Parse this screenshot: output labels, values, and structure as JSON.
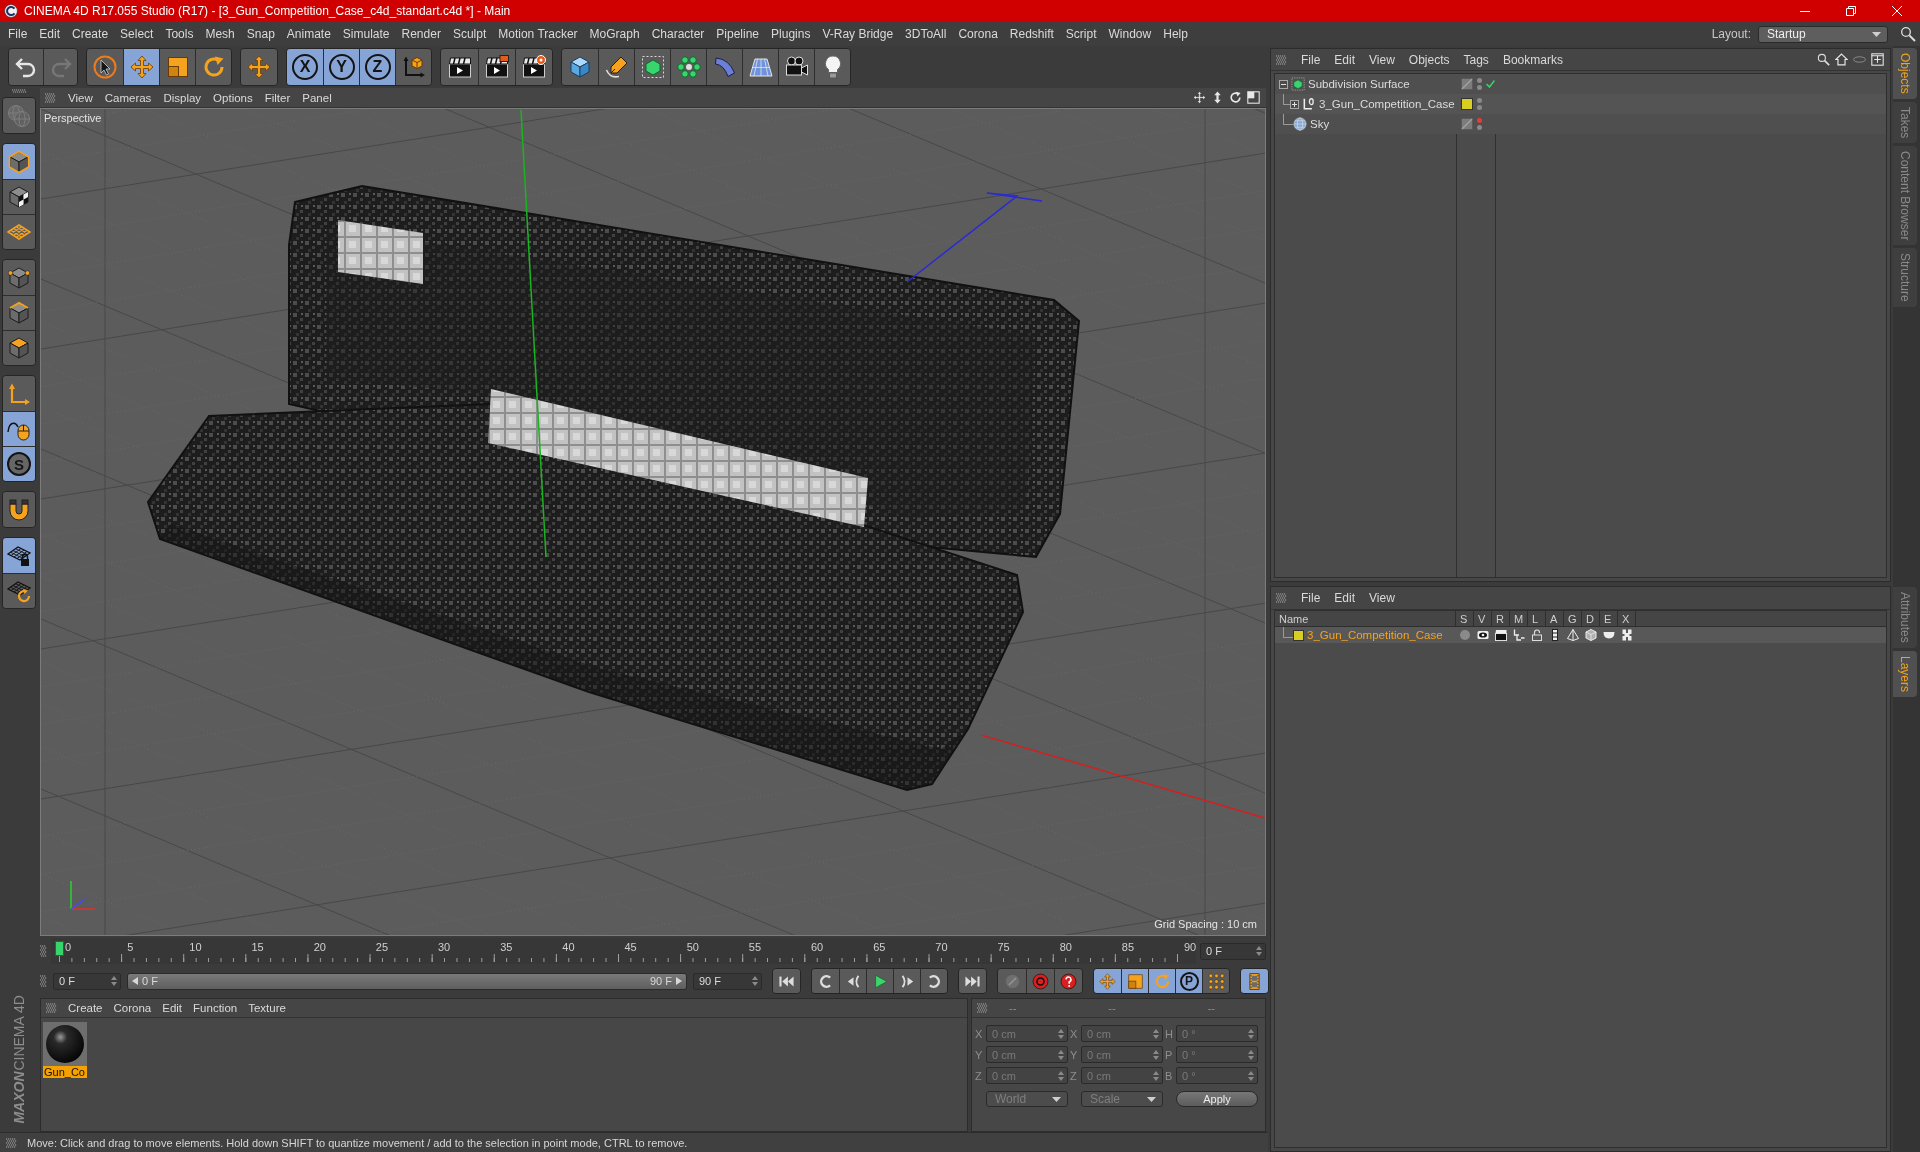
{
  "window": {
    "title": "CINEMA 4D R17.055 Studio (R17) - [3_Gun_Competition_Case_c4d_standart.c4d *] - Main"
  },
  "menu_bar": [
    "File",
    "Edit",
    "Create",
    "Select",
    "Tools",
    "Mesh",
    "Snap",
    "Animate",
    "Simulate",
    "Render",
    "Sculpt",
    "Motion Tracker",
    "MoGraph",
    "Character",
    "Pipeline",
    "Plugins",
    "V-Ray Bridge",
    "3DToAll",
    "Corona",
    "Redshift",
    "Script",
    "Window",
    "Help"
  ],
  "layout": {
    "label": "Layout:",
    "value": "Startup"
  },
  "toolbar": [
    [
      {
        "kind": "undo",
        "selected": false,
        "disabled": false
      },
      {
        "kind": "redo",
        "selected": false,
        "disabled": true
      }
    ],
    [
      {
        "kind": "select",
        "selected": false
      },
      {
        "kind": "move",
        "selected": true
      },
      {
        "kind": "scale",
        "selected": false
      },
      {
        "kind": "rotate",
        "selected": false
      }
    ],
    [
      {
        "kind": "transform",
        "selected": false
      }
    ],
    [
      {
        "kind": "axis-lock",
        "label": "X",
        "selected": true
      },
      {
        "kind": "axis-lock",
        "label": "Y",
        "selected": true
      },
      {
        "kind": "axis-lock",
        "label": "Z",
        "selected": true
      },
      {
        "kind": "coordinates",
        "selected": false
      }
    ],
    [
      {
        "kind": "render-view",
        "selected": false
      },
      {
        "kind": "render-picture",
        "selected": false
      },
      {
        "kind": "render-settings",
        "selected": false
      }
    ],
    [
      {
        "kind": "cube",
        "selected": false
      },
      {
        "kind": "pen",
        "selected": false
      },
      {
        "kind": "subdivision",
        "selected": false
      },
      {
        "kind": "cloner",
        "selected": false
      },
      {
        "kind": "deformer",
        "selected": false
      },
      {
        "kind": "floor",
        "selected": false
      },
      {
        "kind": "camera",
        "selected": false
      },
      {
        "kind": "light",
        "selected": false
      }
    ]
  ],
  "left_toolbar": [
    [
      {
        "kind": "make-editable",
        "selected": false,
        "disabled": true
      }
    ],
    [
      {
        "kind": "model",
        "selected": true
      },
      {
        "kind": "texture",
        "selected": false
      },
      {
        "kind": "workplane",
        "selected": false
      }
    ],
    [
      {
        "kind": "points",
        "selected": false
      },
      {
        "kind": "edges",
        "selected": false
      },
      {
        "kind": "polygons",
        "selected": false
      }
    ],
    [
      {
        "kind": "axis",
        "selected": false
      },
      {
        "kind": "tweak",
        "selected": true
      },
      {
        "kind": "snap",
        "label": "S",
        "selected": true
      }
    ],
    [
      {
        "kind": "magnet",
        "selected": false
      }
    ],
    [
      {
        "kind": "workplane-lock",
        "selected": true
      },
      {
        "kind": "workplane-align",
        "selected": false
      }
    ]
  ],
  "viewport": {
    "menu": [
      "View",
      "Cameras",
      "Display",
      "Options",
      "Filter",
      "Panel"
    ],
    "camera": "Perspective",
    "grid_spacing": "Grid Spacing : 10 cm"
  },
  "timeline": {
    "ticks": [
      "0",
      "5",
      "10",
      "15",
      "20",
      "25",
      "30",
      "35",
      "40",
      "45",
      "50",
      "55",
      "60",
      "65",
      "70",
      "75",
      "80",
      "85",
      "90"
    ],
    "playhead": {
      "level": 0
    },
    "current_frame": "0 F"
  },
  "transport": {
    "start_frame": "0 F",
    "range": {
      "start_label": "0 F",
      "end_label": "90 F",
      "level": 1
    },
    "end_frame": "90 F",
    "buttons": [
      [
        {
          "kind": "go-start",
          "selected": false
        }
      ],
      [
        {
          "kind": "prev-key",
          "selected": false
        },
        {
          "kind": "prev-frame",
          "selected": false
        },
        {
          "kind": "play",
          "selected": false
        },
        {
          "kind": "next-frame",
          "selected": false
        },
        {
          "kind": "next-key",
          "selected": false
        }
      ],
      [
        {
          "kind": "go-end",
          "selected": false
        }
      ],
      [
        {
          "kind": "record",
          "selected": false,
          "disabled": true
        },
        {
          "kind": "autokey",
          "selected": false,
          "disabled": false
        },
        {
          "kind": "key-selection",
          "selected": false,
          "disabled": false
        }
      ],
      [
        {
          "kind": "position",
          "selected": true
        },
        {
          "kind": "scale",
          "selected": true
        },
        {
          "kind": "rotation",
          "selected": true
        },
        {
          "kind": "parameter",
          "label": "P",
          "selected": true
        },
        {
          "kind": "point-level",
          "selected": false
        }
      ],
      [
        {
          "kind": "timeline",
          "selected": true
        }
      ]
    ]
  },
  "material_manager": {
    "menu": [
      "Create",
      "Corona",
      "Edit",
      "Function",
      "Texture"
    ],
    "materials": [
      {
        "name": "Gun_Co",
        "selected": true
      }
    ]
  },
  "coordinates": {
    "headers": [
      "--",
      "--",
      "--"
    ],
    "disabled": true,
    "rows": [
      {
        "position_axis": "X",
        "position": "0 cm",
        "size_axis": "X",
        "size": "0 cm",
        "rotation_axis": "H",
        "rotation": "0 °"
      },
      {
        "position_axis": "Y",
        "position": "0 cm",
        "size_axis": "Y",
        "size": "0 cm",
        "rotation_axis": "P",
        "rotation": "0 °"
      },
      {
        "position_axis": "Z",
        "position": "0 cm",
        "size_axis": "Z",
        "size": "0 cm",
        "rotation_axis": "B",
        "rotation": "0 °"
      }
    ],
    "coordinate_system": "World",
    "size_mode": "Scale",
    "apply": "Apply"
  },
  "logo": {
    "brand": "MAXON",
    "product": "CINEMA 4D"
  },
  "status_bar": "Move: Click and drag to move elements. Hold down SHIFT to quantize movement / add to the selection in point mode, CTRL to remove.",
  "object_manager": {
    "menu": [
      "File",
      "Edit",
      "View",
      "Objects",
      "Tags",
      "Bookmarks"
    ],
    "objects": [
      {
        "kind": "subdivision",
        "name": "Subdivision Surface",
        "selected": false,
        "expanded": true,
        "hidden_in_editor": false,
        "enabled": true,
        "children": [
          {
            "kind": "null",
            "name": "3_Gun_Competition_Case",
            "selected": false,
            "expanded": false,
            "color": "#d8cf22",
            "hidden_in_editor": false,
            "enabled": false
          }
        ]
      },
      {
        "kind": "sky",
        "name": "Sky",
        "selected": false,
        "hidden_in_editor": true,
        "enabled": false
      }
    ]
  },
  "object_tabs": [
    {
      "label": "Objects",
      "selected": true
    },
    {
      "label": "Takes",
      "selected": false
    },
    {
      "label": "Content Browser",
      "selected": false
    },
    {
      "label": "Structure",
      "selected": false
    }
  ],
  "layer_manager": {
    "menu": [
      "File",
      "Edit",
      "View"
    ],
    "columns": [
      "Name",
      "S",
      "V",
      "R",
      "M",
      "L",
      "A",
      "G",
      "D",
      "E",
      "X"
    ],
    "layers": [
      {
        "name": "3_Gun_Competition_Case",
        "color": "#d8cf22",
        "selected": true,
        "solo": false,
        "visible": true,
        "render": true,
        "manager": true,
        "locked": false,
        "animation": true,
        "generators": true,
        "deformers": true,
        "expressions": true,
        "xrefs": true
      }
    ]
  },
  "layer_tabs": [
    {
      "label": "Attributes",
      "selected": false
    },
    {
      "label": "Layers",
      "selected": true
    }
  ]
}
